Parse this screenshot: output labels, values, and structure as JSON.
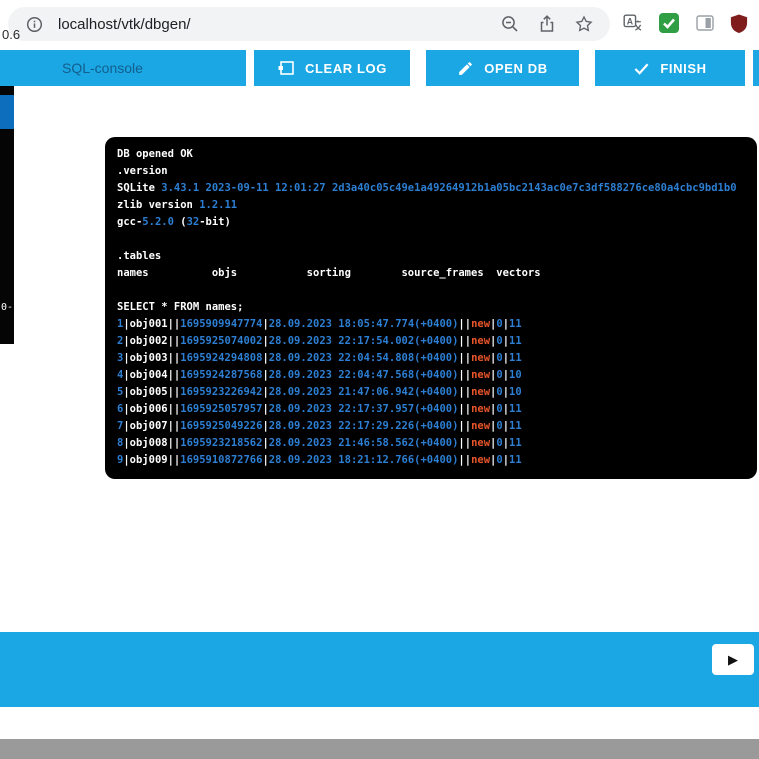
{
  "browser": {
    "url": "localhost/vtk/dbgen/"
  },
  "page": {
    "version_partial": "0.6",
    "sidebar_partial": "0-"
  },
  "toolbar": {
    "title": "SQL-console",
    "buttons": [
      {
        "label": "CLEAR LOG"
      },
      {
        "label": "OPEN DB"
      },
      {
        "label": "FINISH"
      }
    ]
  },
  "console": {
    "intro": [
      [
        [
          "DB opened OK",
          "w"
        ]
      ],
      [
        [
          ".version",
          "w"
        ]
      ],
      [
        [
          "SQLite ",
          "w"
        ],
        [
          "3.43.1 2023-09-11 12:01:27 2d3a40c05c49e1a49264912b1a05bc2143ac0e7c3df588276ce80a4cbc9bd1b0",
          "b"
        ]
      ],
      [
        [
          "zlib version ",
          "w"
        ],
        [
          "1.2.11",
          "b"
        ]
      ],
      [
        [
          "gcc-",
          "w"
        ],
        [
          "5.2.0",
          "b"
        ],
        [
          " (",
          "w"
        ],
        [
          "32",
          "b"
        ],
        [
          "-bit)",
          "w"
        ]
      ],
      [],
      [
        [
          ".tables",
          "w"
        ]
      ],
      [
        [
          "names          objs           sorting        source_frames  vectors",
          "w"
        ]
      ],
      [],
      [
        [
          "SELECT * FROM names;",
          "w"
        ]
      ]
    ],
    "rows": [
      {
        "n": "1",
        "name": "obj001",
        "ts": "1695909947774",
        "dt": "28.09.2023 18:05:47.774(+0400)",
        "flag": "new",
        "a": "0",
        "b": "11"
      },
      {
        "n": "2",
        "name": "obj002",
        "ts": "1695925074002",
        "dt": "28.09.2023 22:17:54.002(+0400)",
        "flag": "new",
        "a": "0",
        "b": "11"
      },
      {
        "n": "3",
        "name": "obj003",
        "ts": "1695924294808",
        "dt": "28.09.2023 22:04:54.808(+0400)",
        "flag": "new",
        "a": "0",
        "b": "11"
      },
      {
        "n": "4",
        "name": "obj004",
        "ts": "1695924287568",
        "dt": "28.09.2023 22:04:47.568(+0400)",
        "flag": "new",
        "a": "0",
        "b": "10"
      },
      {
        "n": "5",
        "name": "obj005",
        "ts": "1695923226942",
        "dt": "28.09.2023 21:47:06.942(+0400)",
        "flag": "new",
        "a": "0",
        "b": "10"
      },
      {
        "n": "6",
        "name": "obj006",
        "ts": "1695925057957",
        "dt": "28.09.2023 22:17:37.957(+0400)",
        "flag": "new",
        "a": "0",
        "b": "11"
      },
      {
        "n": "7",
        "name": "obj007",
        "ts": "1695925049226",
        "dt": "28.09.2023 22:17:29.226(+0400)",
        "flag": "new",
        "a": "0",
        "b": "11"
      },
      {
        "n": "8",
        "name": "obj008",
        "ts": "1695923218562",
        "dt": "28.09.2023 21:46:58.562(+0400)",
        "flag": "new",
        "a": "0",
        "b": "11"
      },
      {
        "n": "9",
        "name": "obj009",
        "ts": "1695910872766",
        "dt": "28.09.2023 18:21:12.766(+0400)",
        "flag": "new",
        "a": "0",
        "b": "11"
      }
    ]
  },
  "bottom_bar": {
    "play_glyph": "▶"
  },
  "colors": {
    "accent_cyan": "#1aa7e4",
    "toolbar_title": "#135e8d",
    "console_bg": "#000000",
    "console_blue": "#2d7fd3",
    "console_orange": "#e8552a",
    "footer_gray": "#9a9a9a"
  }
}
